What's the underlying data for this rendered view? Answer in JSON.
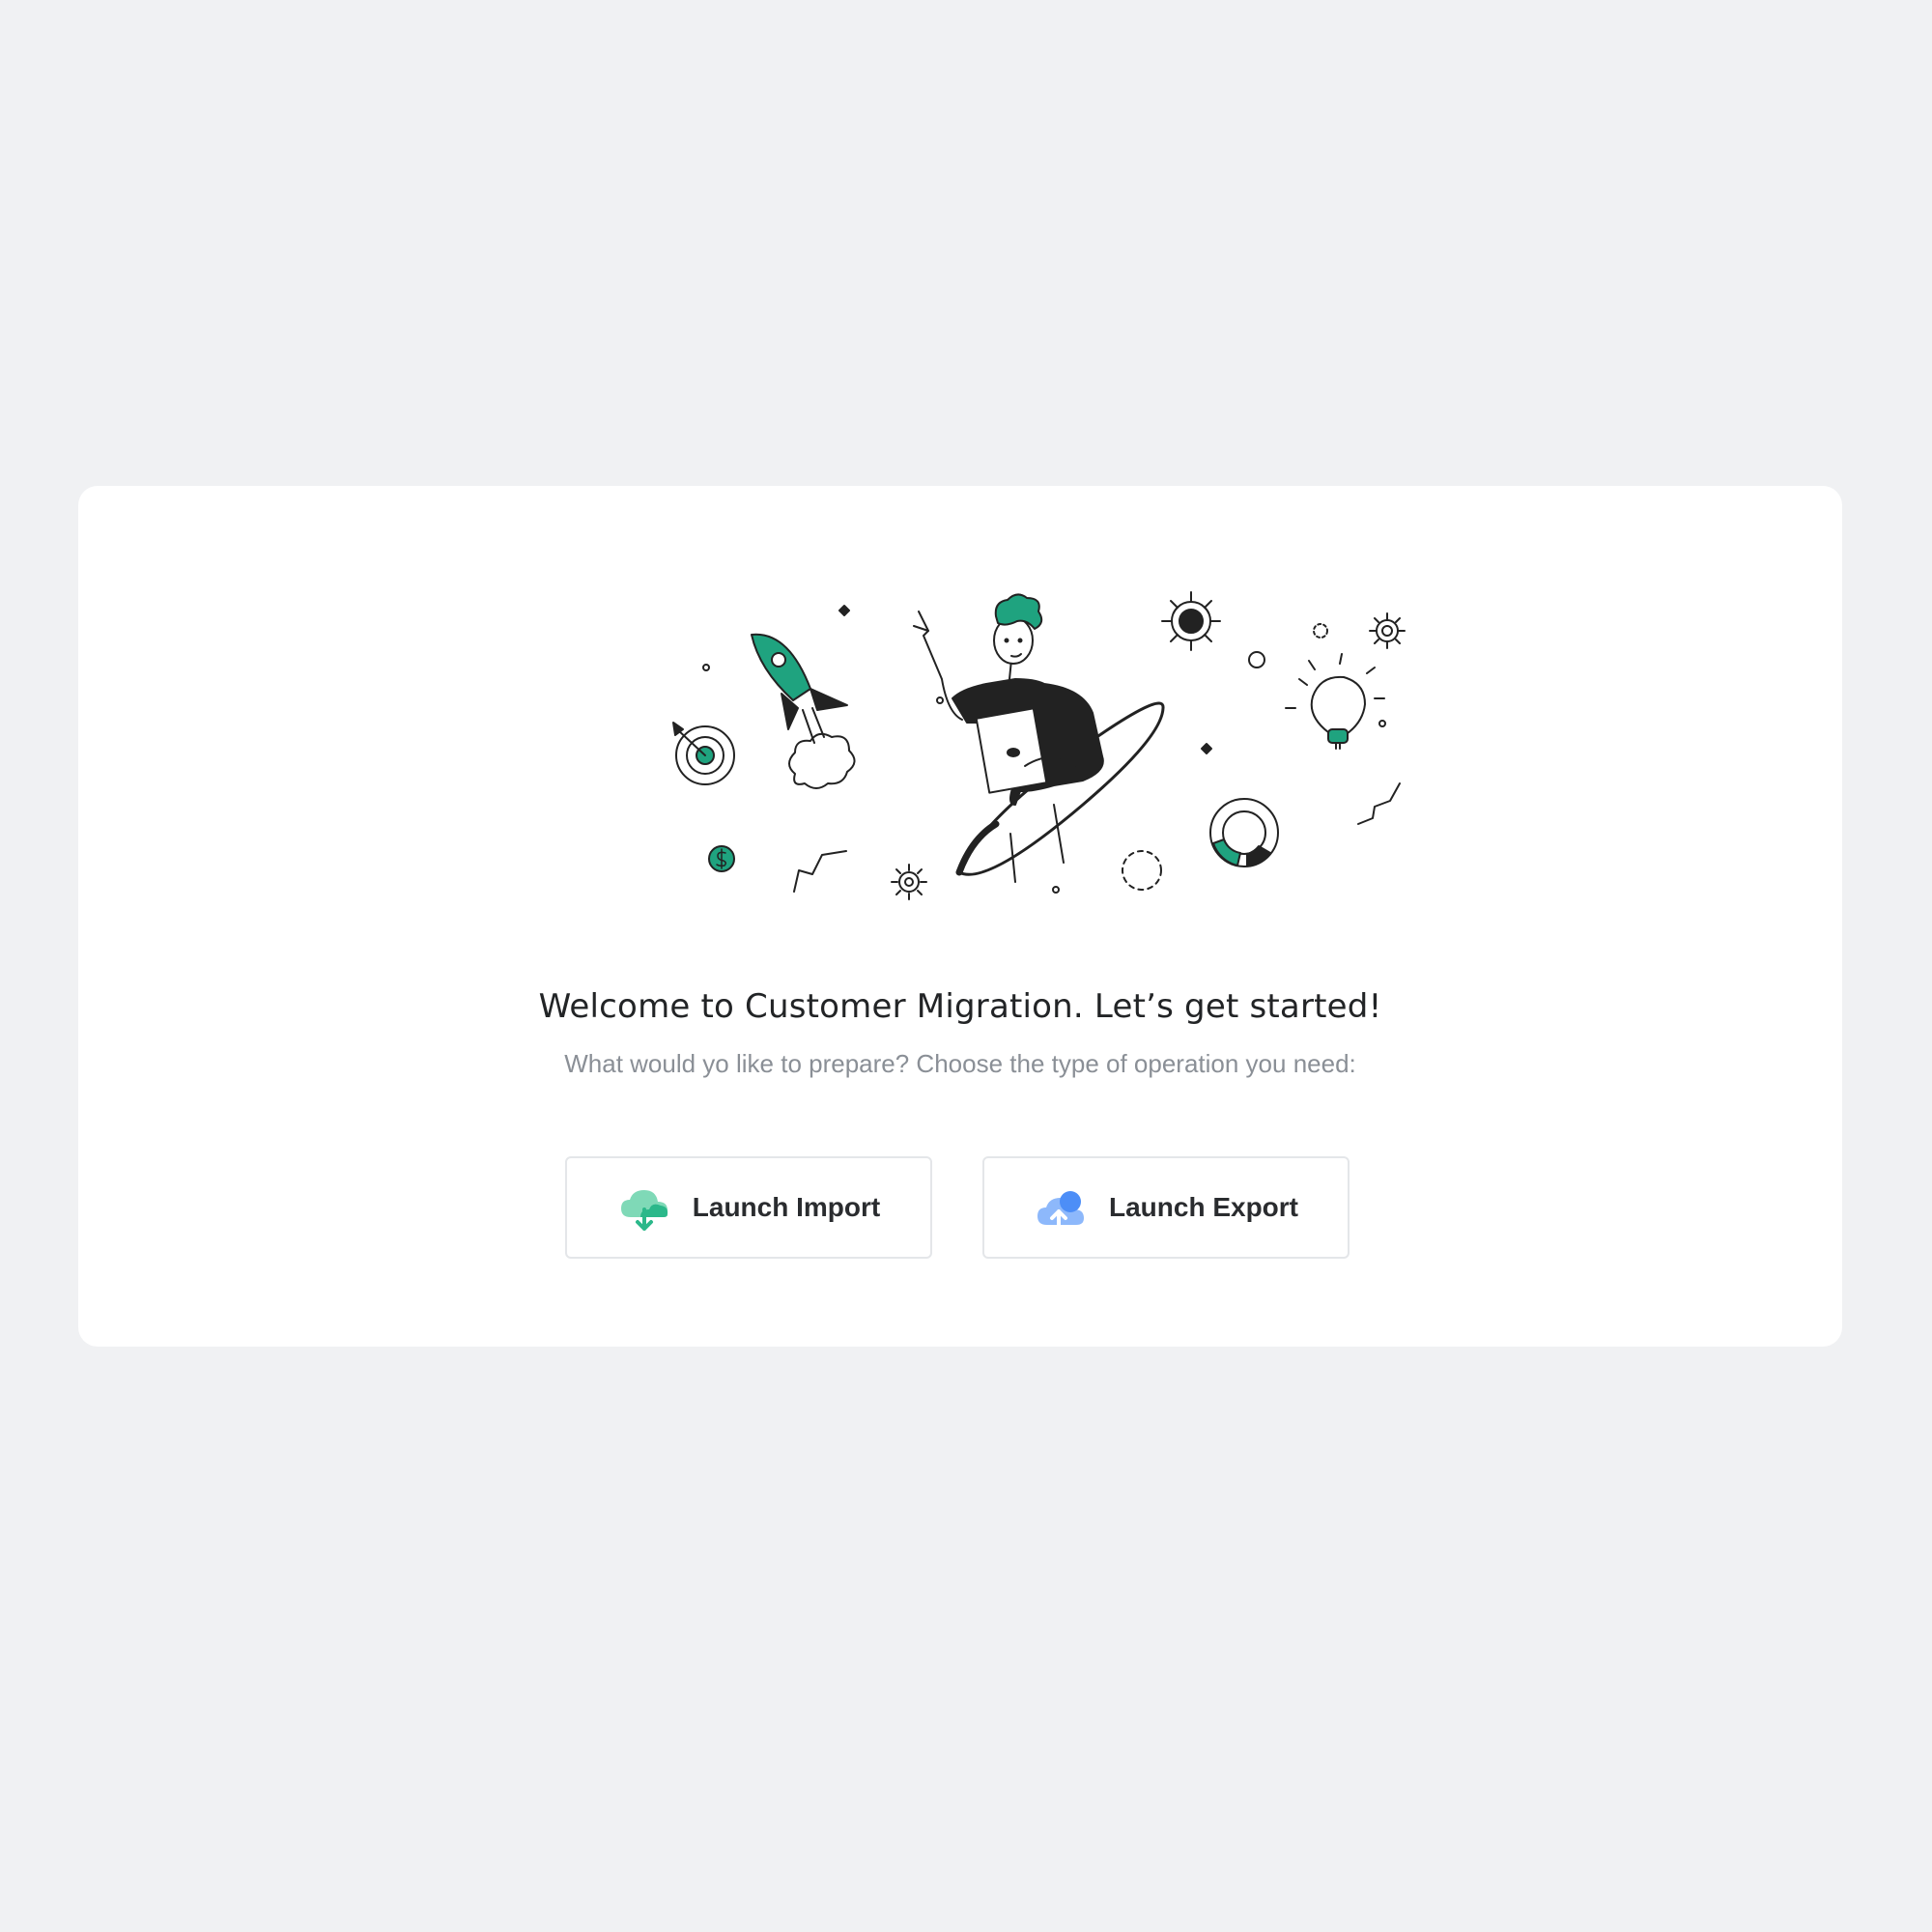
{
  "welcome": {
    "title": "Welcome to Customer Migration. Let’s get started!",
    "subtitle": "What would yo like to prepare? Choose the type of operation you need:"
  },
  "actions": {
    "import": {
      "label": "Launch Import",
      "icon": "cloud-download-icon",
      "color": "#2bb88a"
    },
    "export": {
      "label": "Launch Export",
      "icon": "cloud-upload-icon",
      "color": "#4d8ef7"
    }
  },
  "theme": {
    "background": "#f0f1f3",
    "card": "#ffffff",
    "accent_green": "#1fa37f",
    "ink": "#222426"
  }
}
